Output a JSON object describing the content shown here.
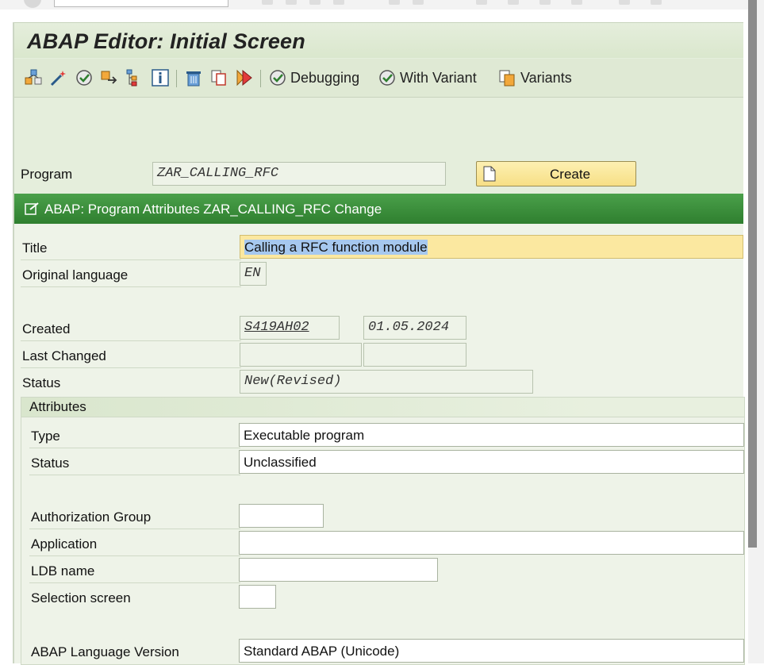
{
  "window": {
    "title": "ABAP Editor: Initial Screen"
  },
  "toolbar": {
    "icons": [
      "hierarchy-icon",
      "magic-wand-icon",
      "check-icon",
      "export-icon",
      "structure-icon",
      "info-icon",
      "trash-icon",
      "copy-icon",
      "activate-icon"
    ],
    "debugging_label": "Debugging",
    "with_variant_label": "With Variant",
    "variants_label": "Variants"
  },
  "program": {
    "label": "Program",
    "value": "ZAR_CALLING_RFC",
    "create_label": "Create"
  },
  "panel": {
    "title": "ABAP: Program Attributes ZAR_CALLING_RFC Change",
    "title_label": "Title",
    "title_value": "Calling a RFC function module",
    "original_language_label": "Original language",
    "original_language_value": "EN",
    "created_label": "Created",
    "created_user": "S419AH02",
    "created_date": "01.05.2024",
    "last_changed_label": "Last Changed",
    "last_changed_user": "",
    "last_changed_date": "",
    "status_label": "Status",
    "status_value": "New(Revised)"
  },
  "attributes": {
    "heading": "Attributes",
    "type_label": "Type",
    "type_value": "Executable program",
    "status_label": "Status",
    "status_value": "Unclassified",
    "auth_group_label": "Authorization Group",
    "auth_group_value": "",
    "application_label": "Application",
    "application_value": "",
    "ldb_label": "LDB name",
    "ldb_value": "",
    "selection_screen_label": "Selection screen",
    "selection_screen_value": "",
    "abap_version_label": "ABAP Language Version",
    "abap_version_value": "Standard ABAP (Unicode)"
  },
  "colors": {
    "panel_header": "#3a8c3a",
    "title_highlight": "#fbe8a0",
    "selection": "#a6c8ef"
  }
}
